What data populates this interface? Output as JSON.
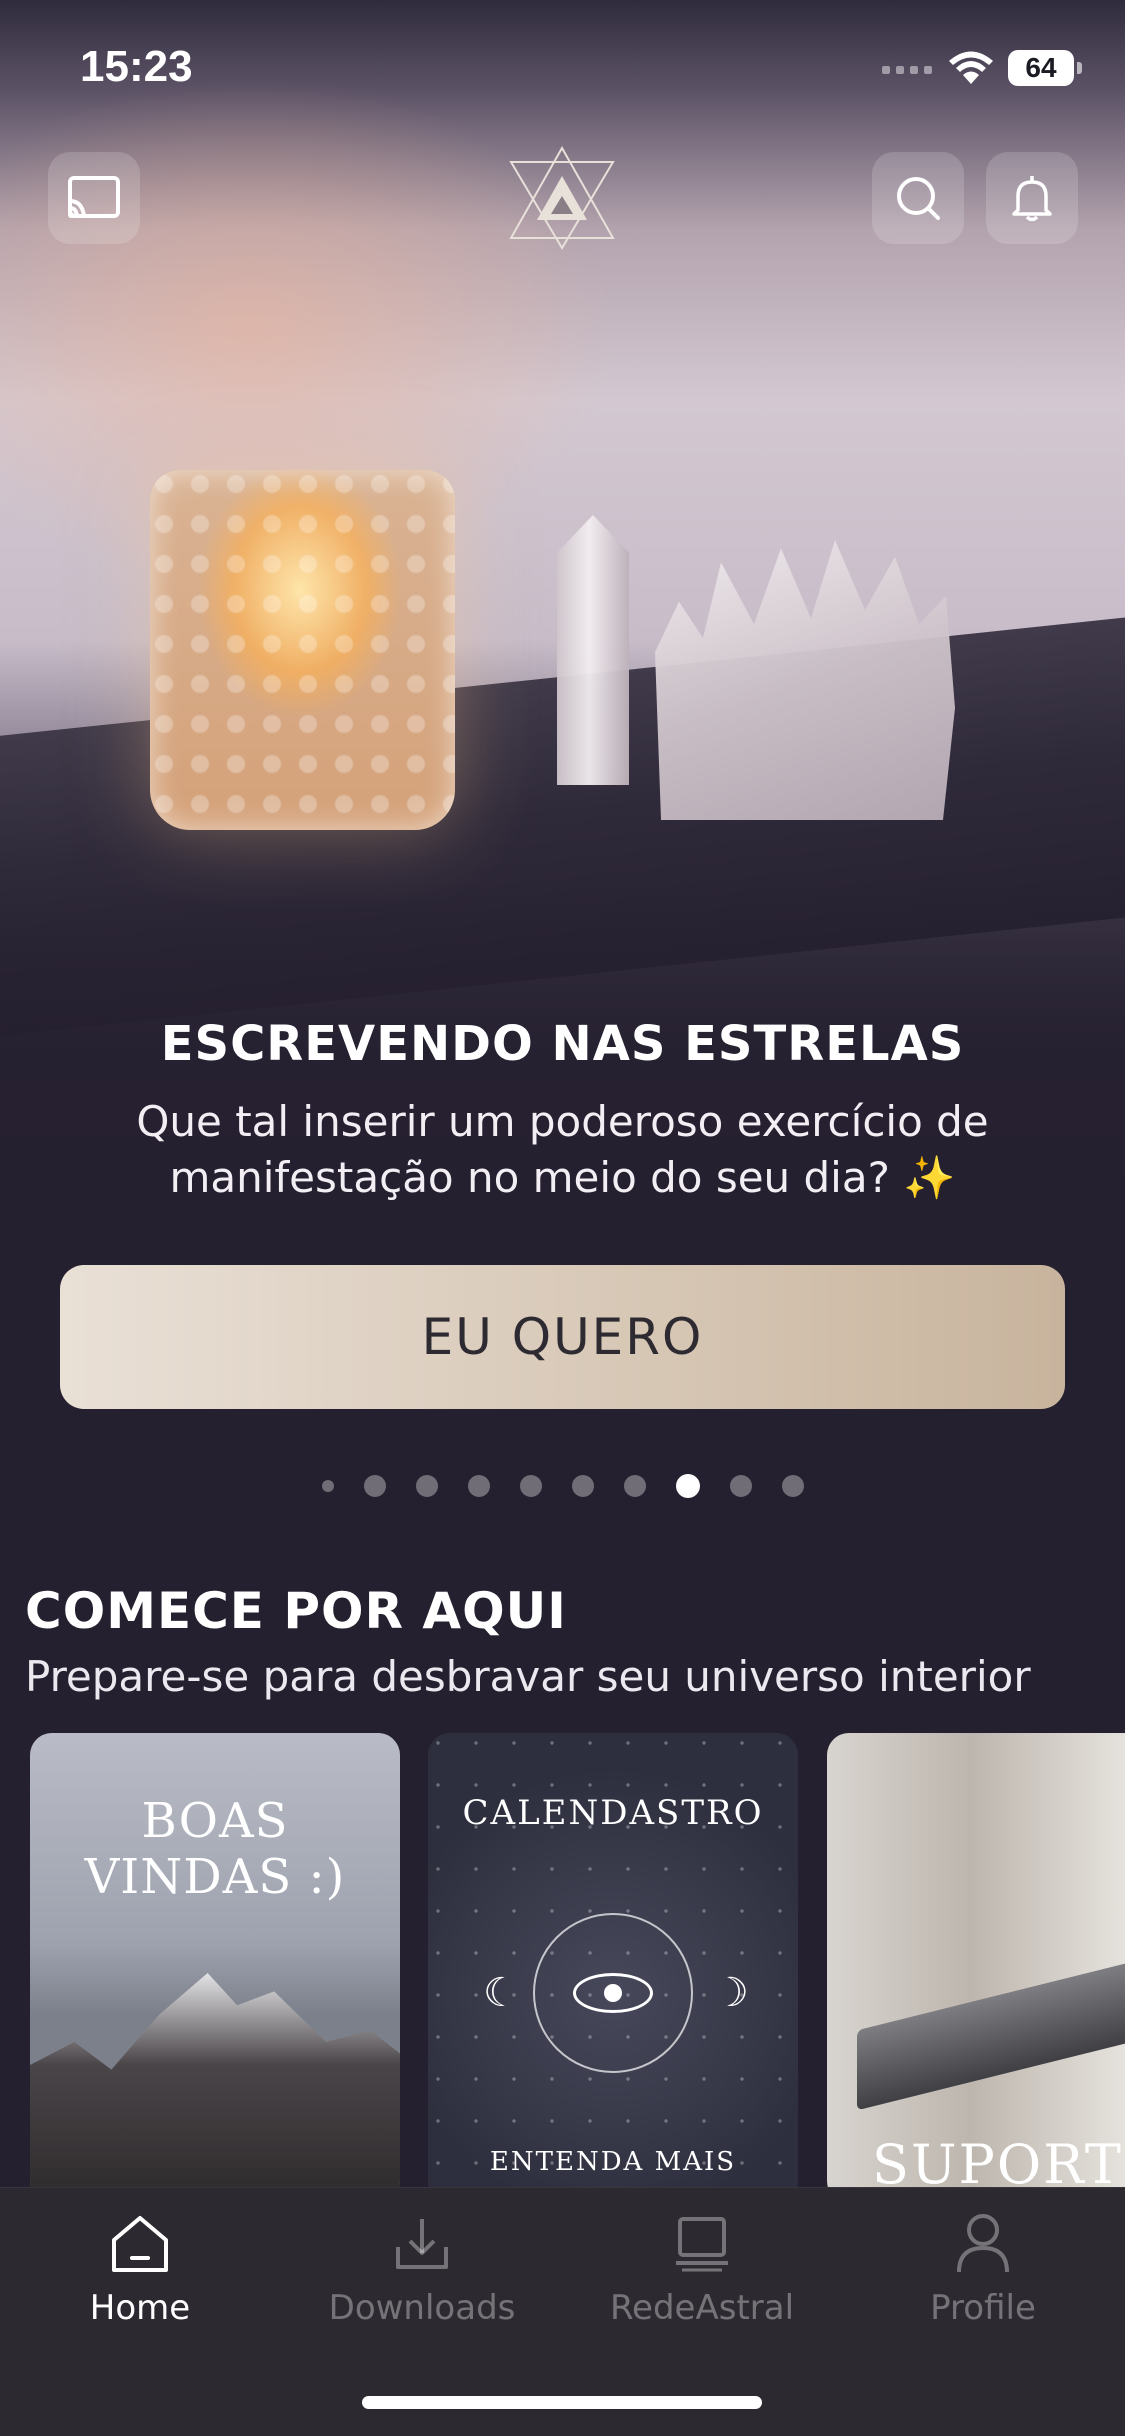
{
  "status_bar": {
    "time": "15:23",
    "battery": "64"
  },
  "top_bar": {
    "cast_icon": "cast-icon",
    "logo_icon": "triangle-star-logo",
    "search_icon": "search-icon",
    "bell_icon": "bell-icon"
  },
  "hero": {
    "title": "ESCREVENDO NAS ESTRELAS",
    "subtitle": "Que tal inserir um poderoso exercício de manifestação no meio do seu dia? ✨",
    "cta_label": "EU QUERO",
    "carousel": {
      "total": 10,
      "active_index": 7
    }
  },
  "section": {
    "title": "COMECE POR AQUI",
    "subtitle": "Prepare-se para desbravar seu universo interior",
    "cards": [
      {
        "line1": "BOAS",
        "line2": "VINDAS :)"
      },
      {
        "top": "CALENDASTRO",
        "bottom": "ENTENDA MAIS"
      },
      {
        "label": "SUPORTE"
      }
    ]
  },
  "tabs": [
    {
      "label": "Home",
      "icon": "home-icon",
      "active": true
    },
    {
      "label": "Downloads",
      "icon": "download-icon",
      "active": false
    },
    {
      "label": "RedeAstral",
      "icon": "monitor-icon",
      "active": false
    },
    {
      "label": "Profile",
      "icon": "person-icon",
      "active": false
    }
  ],
  "colors": {
    "background": "#25202f",
    "cta_gradient_start": "#e9e0d6",
    "cta_gradient_end": "#c8b49d",
    "tabbar": "#2d2930"
  }
}
